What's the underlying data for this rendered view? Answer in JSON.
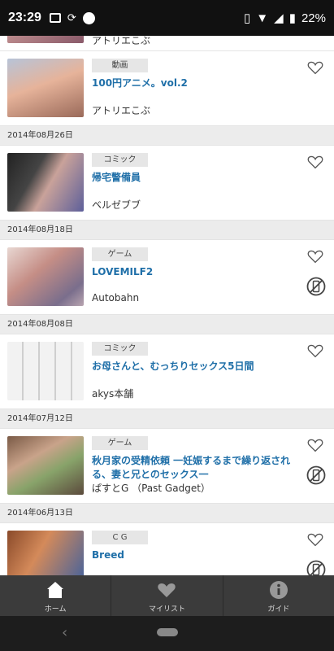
{
  "status": {
    "time": "23:29",
    "battery": "22%"
  },
  "items_top": {
    "title": "アトリエこぶ"
  },
  "items": [
    {
      "tag": "動画",
      "title": "100円アニメ。vol.2",
      "author": "アトリエこぶ",
      "no_app": false
    },
    {
      "date": "2014年08月26日"
    },
    {
      "tag": "コミック",
      "title": "帰宅警備員",
      "author": "ベルゼブブ",
      "no_app": false
    },
    {
      "date": "2014年08月18日"
    },
    {
      "tag": "ゲーム",
      "title": "LOVEMILF2",
      "author": "Autobahn",
      "no_app": true
    },
    {
      "date": "2014年08月08日"
    },
    {
      "tag": "コミック",
      "title": "お母さんと、むっちりセックス5日間",
      "author": "akys本舗",
      "no_app": false
    },
    {
      "date": "2014年07月12日"
    },
    {
      "tag": "ゲーム",
      "title": "秋月家の受精依頼 一妊娠するまで繰り返される、妻と兄とのセックス一",
      "author": "ぱすとG （Past Gadget）",
      "no_app": true
    },
    {
      "date": "2014年06月13日"
    },
    {
      "tag": "C G",
      "title": "Breed",
      "author": "",
      "no_app": true
    }
  ],
  "tabs": [
    {
      "label": "ホーム",
      "icon": "home-icon"
    },
    {
      "label": "マイリスト",
      "icon": "heart-icon"
    },
    {
      "label": "ガイド",
      "icon": "info-icon"
    }
  ],
  "nav": {
    "back": "‹"
  },
  "colors": {
    "title": "#1f6fa8",
    "tabbar": "#3b3b3b",
    "statusbar": "#111111"
  }
}
